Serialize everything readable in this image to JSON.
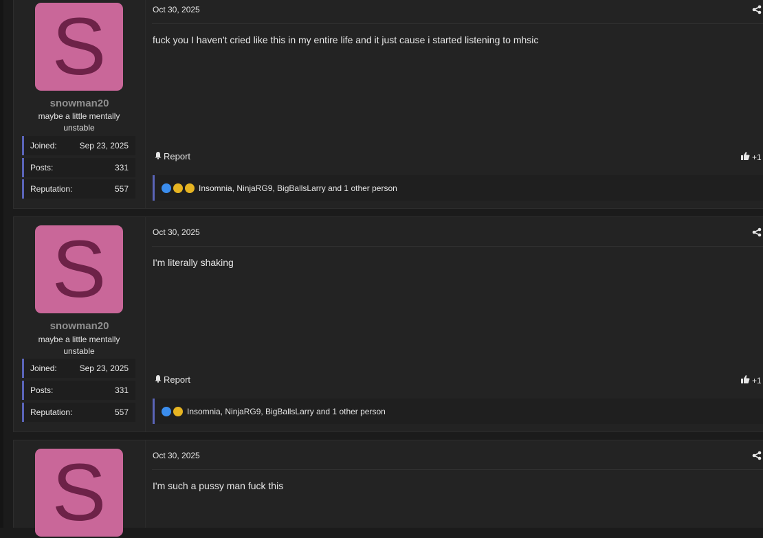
{
  "posts": [
    {
      "date": "Oct 30, 2025",
      "avatar_letter": "S",
      "username": "snowman20",
      "user_title": "maybe a little mentally unstable",
      "stats": [
        {
          "label": "Joined:",
          "value": "Sep 23, 2025"
        },
        {
          "label": "Posts:",
          "value": "331"
        },
        {
          "label": "Reputation:",
          "value": "557"
        }
      ],
      "content": "fuck you I haven't cried like this in my entire life and it just cause i started listening to mhsic",
      "report_label": "Report",
      "reaction_score": "+1",
      "reaction_emojis": [
        "like-icon",
        "sad-icon",
        "laugh-cry-icon"
      ],
      "reactors": "Insomnia, NinjaRG9, BigBallsLarry and 1 other person"
    },
    {
      "date": "Oct 30, 2025",
      "avatar_letter": "S",
      "username": "snowman20",
      "user_title": "maybe a little mentally unstable",
      "stats": [
        {
          "label": "Joined:",
          "value": "Sep 23, 2025"
        },
        {
          "label": "Posts:",
          "value": "331"
        },
        {
          "label": "Reputation:",
          "value": "557"
        }
      ],
      "content": "I'm literally shaking",
      "report_label": "Report",
      "reaction_score": "+1",
      "reaction_emojis": [
        "like-icon",
        "laugh-cry-icon"
      ],
      "reactors": "Insomnia, NinjaRG9, BigBallsLarry and 1 other person"
    },
    {
      "date": "Oct 30, 2025",
      "avatar_letter": "S",
      "content": "I'm such a pussy man fuck this"
    }
  ],
  "colors": {
    "background": "#1b1b1b",
    "post_background": "#232323",
    "avatar_background": "#c96799",
    "avatar_letter": "#6d2248",
    "accent": "#5a64b8"
  }
}
